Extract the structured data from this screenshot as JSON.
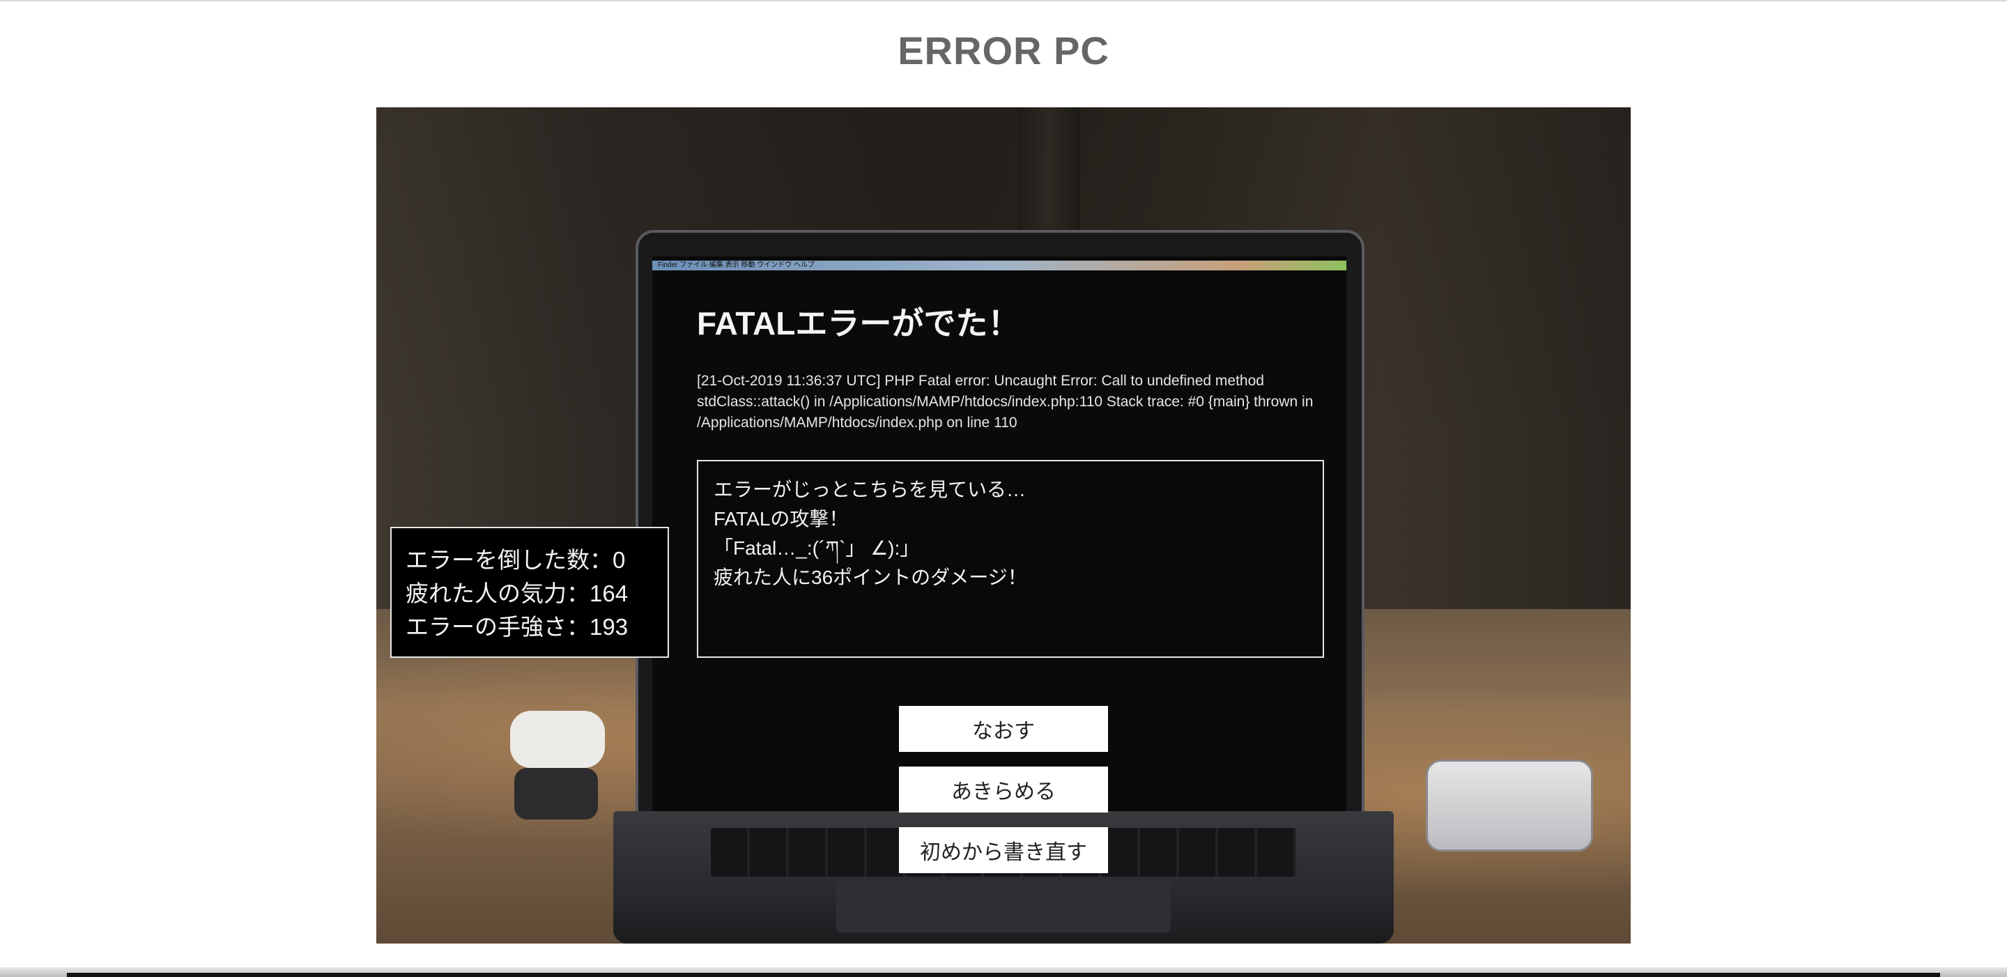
{
  "page": {
    "title": "ERROR PC"
  },
  "error": {
    "heading": "FATALエラーがでた！",
    "log": "[21-Oct-2019 11:36:37 UTC] PHP Fatal error: Uncaught Error: Call to undefined method stdClass::attack() in /Applications/MAMP/htdocs/index.php:110 Stack trace: #0 {main} thrown in /Applications/MAMP/htdocs/index.php on line 110"
  },
  "messages": [
    "エラーがじっとこちらを見ている…",
    "FATALの攻撃！",
    "「Fatal…_:(´ཀ`」 ∠):」",
    "疲れた人に36ポイントのダメージ！"
  ],
  "stats": {
    "defeated": "エラーを倒した数：0",
    "tired_person_energy": "疲れた人の気力：164",
    "error_strength": "エラーの手強さ：193"
  },
  "actions": {
    "fix": "なおす",
    "give_up": "あきらめる",
    "rewrite": "初めから書き直す"
  },
  "laptop_menubar": {
    "text": "Finder  ファイル  編集  表示  移動  ウインドウ  ヘルプ"
  }
}
